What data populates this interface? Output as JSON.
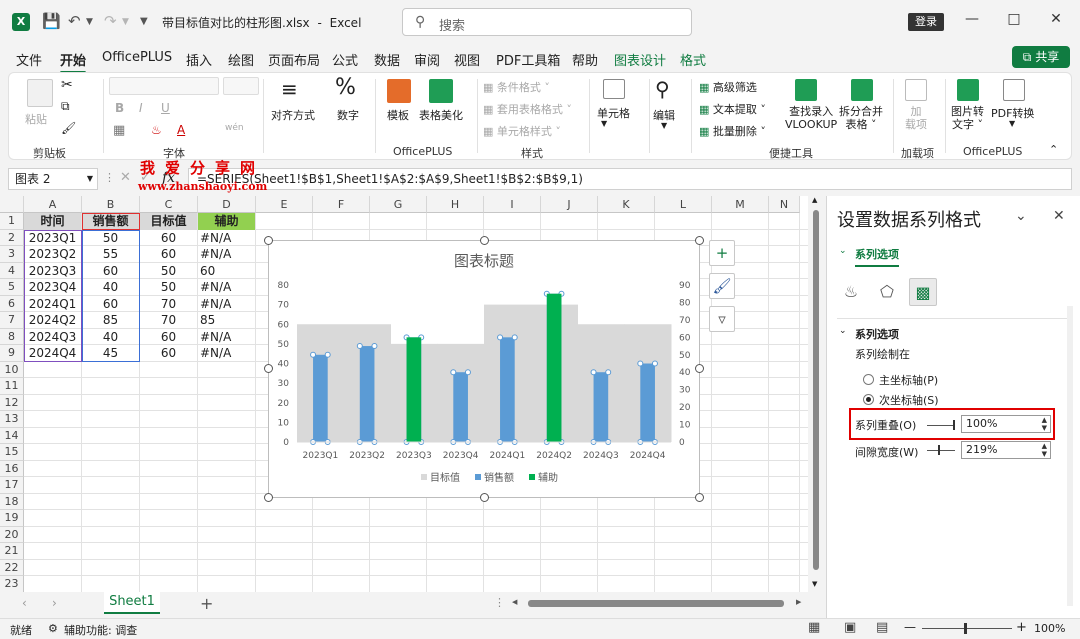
{
  "titlebar": {
    "filename": "带目标值对比的柱形图.xlsx",
    "sep": "-",
    "app": "Excel",
    "search_placeholder": "搜索",
    "login": "登录"
  },
  "menu": {
    "tabs": [
      "文件",
      "开始",
      "OfficePLUS",
      "插入",
      "绘图",
      "页面布局",
      "公式",
      "数据",
      "审阅",
      "视图",
      "PDF工具箱",
      "帮助",
      "图表设计",
      "格式"
    ],
    "active_index": 1,
    "share": "共享"
  },
  "ribbon": {
    "clipboard": {
      "paste": "粘贴",
      "group": "剪贴板"
    },
    "font": {
      "bold": "B",
      "italic": "I",
      "underline": "U",
      "group": "字体"
    },
    "align": {
      "label": "对齐方式"
    },
    "number": {
      "label": "数字",
      "icon_glyph": "%"
    },
    "officeplus1": {
      "template": "模板",
      "beautify": "表格美化",
      "group": "OfficePLUS"
    },
    "styles": {
      "conditional": "条件格式",
      "table_format": "套用表格格式",
      "cell_style": "单元格样式",
      "group": "样式"
    },
    "cells": {
      "label": "单元格"
    },
    "edit": {
      "label": "编辑"
    },
    "tools": {
      "adv_filter": "高级筛选",
      "text_extract": "文本提取",
      "batch_delete": "批量删除",
      "vlookup_line1": "查找录入",
      "vlookup_line2": "VLOOKUP",
      "split_line1": "拆分合并",
      "split_line2": "表格",
      "group": "便捷工具"
    },
    "addins": {
      "line1": "加",
      "line2": "载项",
      "group": "加载项"
    },
    "officeplus2": {
      "img_line1": "图片转",
      "img_line2": "文字",
      "pdf": "PDF转换",
      "group": "OfficePLUS"
    }
  },
  "formula": {
    "name_box": "图表 2",
    "fx": "fx",
    "content": "=SERIES(Sheet1!$B$1,Sheet1!$A$2:$A$9,Sheet1!$B$2:$B$9,1)"
  },
  "sheet": {
    "columns": [
      "A",
      "B",
      "C",
      "D",
      "E",
      "F",
      "G",
      "H",
      "I",
      "J",
      "K",
      "L",
      "M",
      "N"
    ],
    "rows": [
      "1",
      "2",
      "3",
      "4",
      "5",
      "6",
      "7",
      "8",
      "9",
      "10",
      "11",
      "12",
      "13",
      "14",
      "15",
      "16",
      "17",
      "18",
      "19",
      "20",
      "21",
      "22",
      "23"
    ],
    "headers": [
      "时间",
      "销售额",
      "目标值",
      "辅助"
    ],
    "data": [
      [
        "2023Q1",
        "50",
        "60",
        "#N/A"
      ],
      [
        "2023Q2",
        "55",
        "60",
        "#N/A"
      ],
      [
        "2023Q3",
        "60",
        "50",
        "60"
      ],
      [
        "2023Q4",
        "40",
        "50",
        "#N/A"
      ],
      [
        "2024Q1",
        "60",
        "70",
        "#N/A"
      ],
      [
        "2024Q2",
        "85",
        "70",
        "85"
      ],
      [
        "2024Q3",
        "40",
        "60",
        "#N/A"
      ],
      [
        "2024Q4",
        "45",
        "60",
        "#N/A"
      ]
    ],
    "watermark_cn": "我爱分享网",
    "watermark_url": "www.zhanshaoyi.com",
    "tab_name": "Sheet1"
  },
  "chart_data": {
    "type": "bar",
    "title": "图表标题",
    "categories": [
      "2023Q1",
      "2023Q2",
      "2023Q3",
      "2023Q4",
      "2024Q1",
      "2024Q2",
      "2024Q3",
      "2024Q4"
    ],
    "series": [
      {
        "name": "目标值",
        "axis": "primary",
        "values": [
          60,
          60,
          50,
          50,
          70,
          70,
          60,
          60
        ],
        "color": "#d9d9d9"
      },
      {
        "name": "销售额",
        "axis": "secondary",
        "values": [
          50,
          55,
          60,
          40,
          60,
          85,
          40,
          45
        ],
        "color": "#5b9bd5"
      },
      {
        "name": "辅助",
        "axis": "secondary",
        "values": [
          null,
          null,
          60,
          null,
          null,
          85,
          null,
          null
        ],
        "color": "#00b050"
      }
    ],
    "primary_axis": {
      "ylim": [
        0,
        80
      ],
      "ticks": [
        0,
        10,
        20,
        30,
        40,
        50,
        60,
        70,
        80
      ]
    },
    "secondary_axis": {
      "ylim": [
        0,
        90
      ],
      "ticks": [
        0,
        10,
        20,
        30,
        40,
        50,
        60,
        70,
        80,
        90
      ]
    },
    "legend": "bottom",
    "grid": false
  },
  "pane": {
    "title": "设置数据系列格式",
    "tab": "系列选项",
    "section": "系列选项",
    "plot_on": "系列绘制在",
    "primary_axis": "主坐标轴(P)",
    "secondary_axis": "次坐标轴(S)",
    "overlap_label": "系列重叠(O)",
    "overlap_value": "100%",
    "overlap_fraction": 1.0,
    "gap_label": "间隙宽度(W)",
    "gap_value": "219%",
    "gap_fraction": 0.438,
    "highlight_color": "#e00000"
  },
  "status": {
    "ready": "就绪",
    "accessibility": "辅助功能: 调查",
    "zoom": "100%"
  },
  "colors": {
    "excel_green": "#107c41"
  }
}
